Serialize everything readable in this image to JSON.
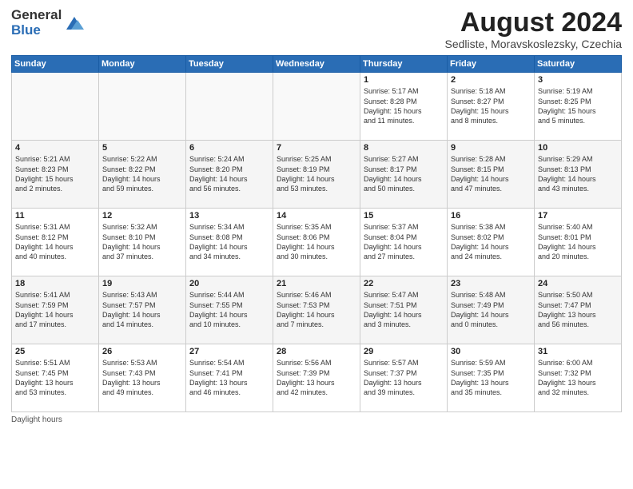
{
  "header": {
    "logo_general": "General",
    "logo_blue": "Blue",
    "month": "August 2024",
    "location": "Sedliste, Moravskoslezsky, Czechia"
  },
  "days_of_week": [
    "Sunday",
    "Monday",
    "Tuesday",
    "Wednesday",
    "Thursday",
    "Friday",
    "Saturday"
  ],
  "weeks": [
    [
      {
        "day": "",
        "info": ""
      },
      {
        "day": "",
        "info": ""
      },
      {
        "day": "",
        "info": ""
      },
      {
        "day": "",
        "info": ""
      },
      {
        "day": "1",
        "info": "Sunrise: 5:17 AM\nSunset: 8:28 PM\nDaylight: 15 hours\nand 11 minutes."
      },
      {
        "day": "2",
        "info": "Sunrise: 5:18 AM\nSunset: 8:27 PM\nDaylight: 15 hours\nand 8 minutes."
      },
      {
        "day": "3",
        "info": "Sunrise: 5:19 AM\nSunset: 8:25 PM\nDaylight: 15 hours\nand 5 minutes."
      }
    ],
    [
      {
        "day": "4",
        "info": "Sunrise: 5:21 AM\nSunset: 8:23 PM\nDaylight: 15 hours\nand 2 minutes."
      },
      {
        "day": "5",
        "info": "Sunrise: 5:22 AM\nSunset: 8:22 PM\nDaylight: 14 hours\nand 59 minutes."
      },
      {
        "day": "6",
        "info": "Sunrise: 5:24 AM\nSunset: 8:20 PM\nDaylight: 14 hours\nand 56 minutes."
      },
      {
        "day": "7",
        "info": "Sunrise: 5:25 AM\nSunset: 8:19 PM\nDaylight: 14 hours\nand 53 minutes."
      },
      {
        "day": "8",
        "info": "Sunrise: 5:27 AM\nSunset: 8:17 PM\nDaylight: 14 hours\nand 50 minutes."
      },
      {
        "day": "9",
        "info": "Sunrise: 5:28 AM\nSunset: 8:15 PM\nDaylight: 14 hours\nand 47 minutes."
      },
      {
        "day": "10",
        "info": "Sunrise: 5:29 AM\nSunset: 8:13 PM\nDaylight: 14 hours\nand 43 minutes."
      }
    ],
    [
      {
        "day": "11",
        "info": "Sunrise: 5:31 AM\nSunset: 8:12 PM\nDaylight: 14 hours\nand 40 minutes."
      },
      {
        "day": "12",
        "info": "Sunrise: 5:32 AM\nSunset: 8:10 PM\nDaylight: 14 hours\nand 37 minutes."
      },
      {
        "day": "13",
        "info": "Sunrise: 5:34 AM\nSunset: 8:08 PM\nDaylight: 14 hours\nand 34 minutes."
      },
      {
        "day": "14",
        "info": "Sunrise: 5:35 AM\nSunset: 8:06 PM\nDaylight: 14 hours\nand 30 minutes."
      },
      {
        "day": "15",
        "info": "Sunrise: 5:37 AM\nSunset: 8:04 PM\nDaylight: 14 hours\nand 27 minutes."
      },
      {
        "day": "16",
        "info": "Sunrise: 5:38 AM\nSunset: 8:02 PM\nDaylight: 14 hours\nand 24 minutes."
      },
      {
        "day": "17",
        "info": "Sunrise: 5:40 AM\nSunset: 8:01 PM\nDaylight: 14 hours\nand 20 minutes."
      }
    ],
    [
      {
        "day": "18",
        "info": "Sunrise: 5:41 AM\nSunset: 7:59 PM\nDaylight: 14 hours\nand 17 minutes."
      },
      {
        "day": "19",
        "info": "Sunrise: 5:43 AM\nSunset: 7:57 PM\nDaylight: 14 hours\nand 14 minutes."
      },
      {
        "day": "20",
        "info": "Sunrise: 5:44 AM\nSunset: 7:55 PM\nDaylight: 14 hours\nand 10 minutes."
      },
      {
        "day": "21",
        "info": "Sunrise: 5:46 AM\nSunset: 7:53 PM\nDaylight: 14 hours\nand 7 minutes."
      },
      {
        "day": "22",
        "info": "Sunrise: 5:47 AM\nSunset: 7:51 PM\nDaylight: 14 hours\nand 3 minutes."
      },
      {
        "day": "23",
        "info": "Sunrise: 5:48 AM\nSunset: 7:49 PM\nDaylight: 14 hours\nand 0 minutes."
      },
      {
        "day": "24",
        "info": "Sunrise: 5:50 AM\nSunset: 7:47 PM\nDaylight: 13 hours\nand 56 minutes."
      }
    ],
    [
      {
        "day": "25",
        "info": "Sunrise: 5:51 AM\nSunset: 7:45 PM\nDaylight: 13 hours\nand 53 minutes."
      },
      {
        "day": "26",
        "info": "Sunrise: 5:53 AM\nSunset: 7:43 PM\nDaylight: 13 hours\nand 49 minutes."
      },
      {
        "day": "27",
        "info": "Sunrise: 5:54 AM\nSunset: 7:41 PM\nDaylight: 13 hours\nand 46 minutes."
      },
      {
        "day": "28",
        "info": "Sunrise: 5:56 AM\nSunset: 7:39 PM\nDaylight: 13 hours\nand 42 minutes."
      },
      {
        "day": "29",
        "info": "Sunrise: 5:57 AM\nSunset: 7:37 PM\nDaylight: 13 hours\nand 39 minutes."
      },
      {
        "day": "30",
        "info": "Sunrise: 5:59 AM\nSunset: 7:35 PM\nDaylight: 13 hours\nand 35 minutes."
      },
      {
        "day": "31",
        "info": "Sunrise: 6:00 AM\nSunset: 7:32 PM\nDaylight: 13 hours\nand 32 minutes."
      }
    ]
  ],
  "footer": "Daylight hours"
}
